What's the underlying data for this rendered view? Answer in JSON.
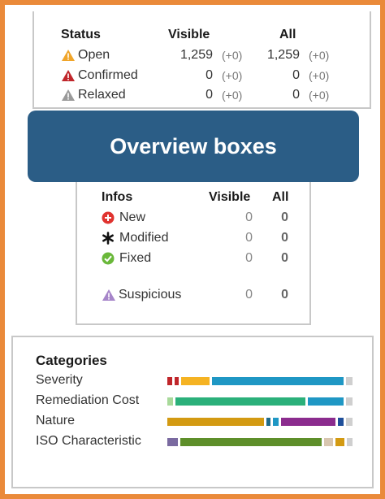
{
  "colors": {
    "frame": "#ea8a3a",
    "banner_bg": "#2b5d86",
    "open_icon": "#f0a52a",
    "confirmed_icon": "#c0262b",
    "relaxed_icon": "#9a9a9a",
    "new_icon": "#e0332f",
    "fixed_icon": "#6ab83a",
    "suspicious_icon": "#a685c9"
  },
  "status": {
    "header": "Status",
    "col_visible": "Visible",
    "col_all": "All",
    "rows": [
      {
        "label": "Open",
        "visible": "1,259",
        "visible_delta": "(+0)",
        "all": "1,259",
        "all_delta": "(+0)",
        "icon": "warning-triangle-orange"
      },
      {
        "label": "Confirmed",
        "visible": "0",
        "visible_delta": "(+0)",
        "all": "0",
        "all_delta": "(+0)",
        "icon": "warning-triangle-red"
      },
      {
        "label": "Relaxed",
        "visible": "0",
        "visible_delta": "(+0)",
        "all": "0",
        "all_delta": "(+0)",
        "icon": "warning-triangle-gray"
      }
    ]
  },
  "banner": {
    "text": "Overview boxes"
  },
  "infos": {
    "header": "Infos",
    "col_visible": "Visible",
    "col_all": "All",
    "rows": [
      {
        "label": "New",
        "visible": "0",
        "all": "0",
        "icon": "plus-circle"
      },
      {
        "label": "Modified",
        "visible": "0",
        "all": "0",
        "icon": "asterisk"
      },
      {
        "label": "Fixed",
        "visible": "0",
        "all": "0",
        "icon": "check-circle"
      },
      {
        "label": "Suspicious",
        "visible": "0",
        "all": "0",
        "icon": "warning-triangle-purple"
      }
    ]
  },
  "categories": {
    "header": "Categories",
    "rows": [
      {
        "label": "Severity",
        "segments": [
          {
            "frac": 0.025,
            "color": "#c0262b"
          },
          {
            "frac": 0.022,
            "color": "#c0262b"
          },
          {
            "frac": 0.16,
            "color": "#f5b323"
          },
          {
            "frac": 0.72,
            "color": "#1f97c4"
          },
          {
            "frac": 0.035,
            "color": "#cfcfcf"
          }
        ]
      },
      {
        "label": "Remediation Cost",
        "segments": [
          {
            "frac": 0.03,
            "color": "#a8d99a"
          },
          {
            "frac": 0.72,
            "color": "#2bb07a"
          },
          {
            "frac": 0.2,
            "color": "#1f97c4"
          },
          {
            "frac": 0.035,
            "color": "#cfcfcf"
          }
        ]
      },
      {
        "label": "Nature",
        "segments": [
          {
            "frac": 0.53,
            "color": "#d39a12"
          },
          {
            "frac": 0.02,
            "color": "#1f6b8a"
          },
          {
            "frac": 0.03,
            "color": "#1f97c4"
          },
          {
            "frac": 0.3,
            "color": "#8b2c8e"
          },
          {
            "frac": 0.03,
            "color": "#1f4f9a"
          },
          {
            "frac": 0.035,
            "color": "#cfcfcf"
          }
        ]
      },
      {
        "label": "ISO Characteristic",
        "segments": [
          {
            "frac": 0.06,
            "color": "#7a6aa0"
          },
          {
            "frac": 0.78,
            "color": "#5e8f2a"
          },
          {
            "frac": 0.05,
            "color": "#d8c6b0"
          },
          {
            "frac": 0.05,
            "color": "#d39a12"
          },
          {
            "frac": 0.03,
            "color": "#cfcfcf"
          }
        ]
      }
    ]
  }
}
